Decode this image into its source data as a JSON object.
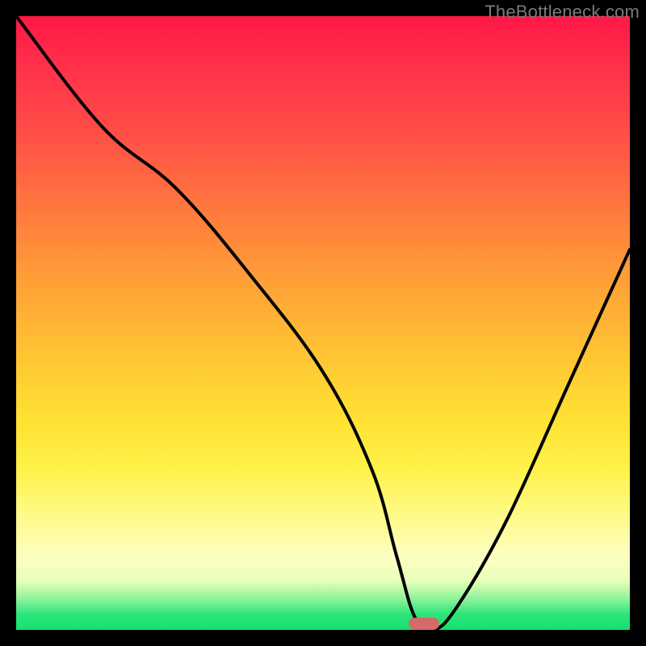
{
  "watermark": "TheBottleneck.com",
  "chart_data": {
    "type": "line",
    "title": "",
    "xlabel": "",
    "ylabel": "",
    "xlim": [
      0,
      100
    ],
    "ylim": [
      0,
      100
    ],
    "series": [
      {
        "name": "bottleneck-curve",
        "x": [
          0,
          14,
          26,
          38,
          50,
          58,
          62,
          65,
          68,
          72,
          80,
          90,
          100
        ],
        "values": [
          100,
          82,
          72,
          58,
          42,
          26,
          12,
          2,
          0,
          4,
          18,
          40,
          62
        ]
      }
    ],
    "optimum_marker": {
      "x": 66.5,
      "y": 0,
      "width": 5,
      "height": 2
    }
  },
  "colors": {
    "background": "#000000",
    "curve": "#000000",
    "marker": "#d46a6a"
  }
}
